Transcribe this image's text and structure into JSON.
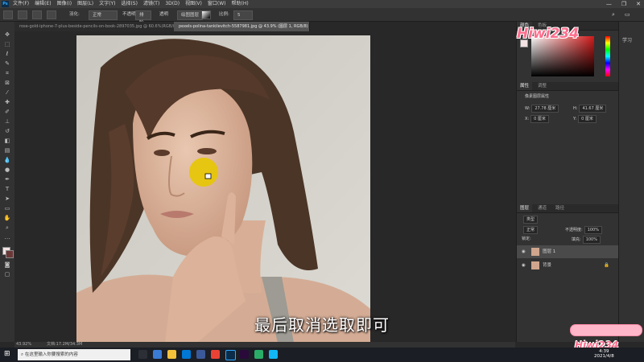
{
  "app": {
    "logo": "Ps"
  },
  "menu": [
    "文件(F)",
    "编辑(E)",
    "图像(I)",
    "图层(L)",
    "文字(Y)",
    "选择(S)",
    "滤镜(T)",
    "3D(D)",
    "视图(V)",
    "窗口(W)",
    "帮助(H)"
  ],
  "window_controls": [
    "—",
    "❐",
    "✕"
  ],
  "options": {
    "feather_label": "羽化:",
    "feather_value": "0 像素",
    "style_label": "正常",
    "width_label": "宽度:",
    "height_label": "高度:",
    "antialias_label": "消除锯齿",
    "select_mask": "选择并遮住...",
    "mode_label": "正常",
    "opacity_label": "不透明度:",
    "opacity_value": "5",
    "mode2": "排除",
    "transparent": "透明",
    "sample": "绘图图层",
    "ratio_label": "比例:"
  },
  "tabs": [
    {
      "label": "rose-gold-iphone-7-plus-beside-pencils-on-book-2897035.jpg @ 60.6%(RGB/8) *",
      "active": false
    },
    {
      "label": "pexels-polina-tankilevitch-5587981.jpg @ 43.9% (图层 1, RGB/8) *",
      "active": true
    }
  ],
  "status": {
    "zoom": "43.92%",
    "doc": "文档:17.2M/34.3M"
  },
  "right_panel": {
    "top_tabs": [
      "颜色",
      "色板"
    ],
    "props_tabs": [
      "属性",
      "调整"
    ],
    "props_title": "像素图层属性",
    "w_label": "W:",
    "w_value": "27.78 厘米",
    "h_label": "H:",
    "h_value": "41.67 厘米",
    "x_label": "X:",
    "x_value": "0 厘米",
    "y_label": "Y:",
    "y_value": "0 厘米",
    "layers_tabs": [
      "图层",
      "通道",
      "路径"
    ],
    "kind_label": "类型",
    "blend_mode": "正常",
    "opacity_label": "不透明度:",
    "opacity_value": "100%",
    "lock_label": "锁定:",
    "fill_label": "填充:",
    "fill_value": "100%",
    "layers": [
      {
        "name": "图层 1",
        "selected": true
      },
      {
        "name": "背景",
        "selected": false
      }
    ],
    "strip_labels": [
      "学习"
    ]
  },
  "subtitle": "最后取消选取即可",
  "watermark": "Hiwi234",
  "taskbar": {
    "search_placeholder": "在这里输入你要搜索的内容",
    "time": "4:39",
    "date": "2021/4/8"
  },
  "colors": {
    "accent": "#31a8ff",
    "watermark": "#ff6f8e",
    "yellow_brush": "#e6c60a"
  }
}
